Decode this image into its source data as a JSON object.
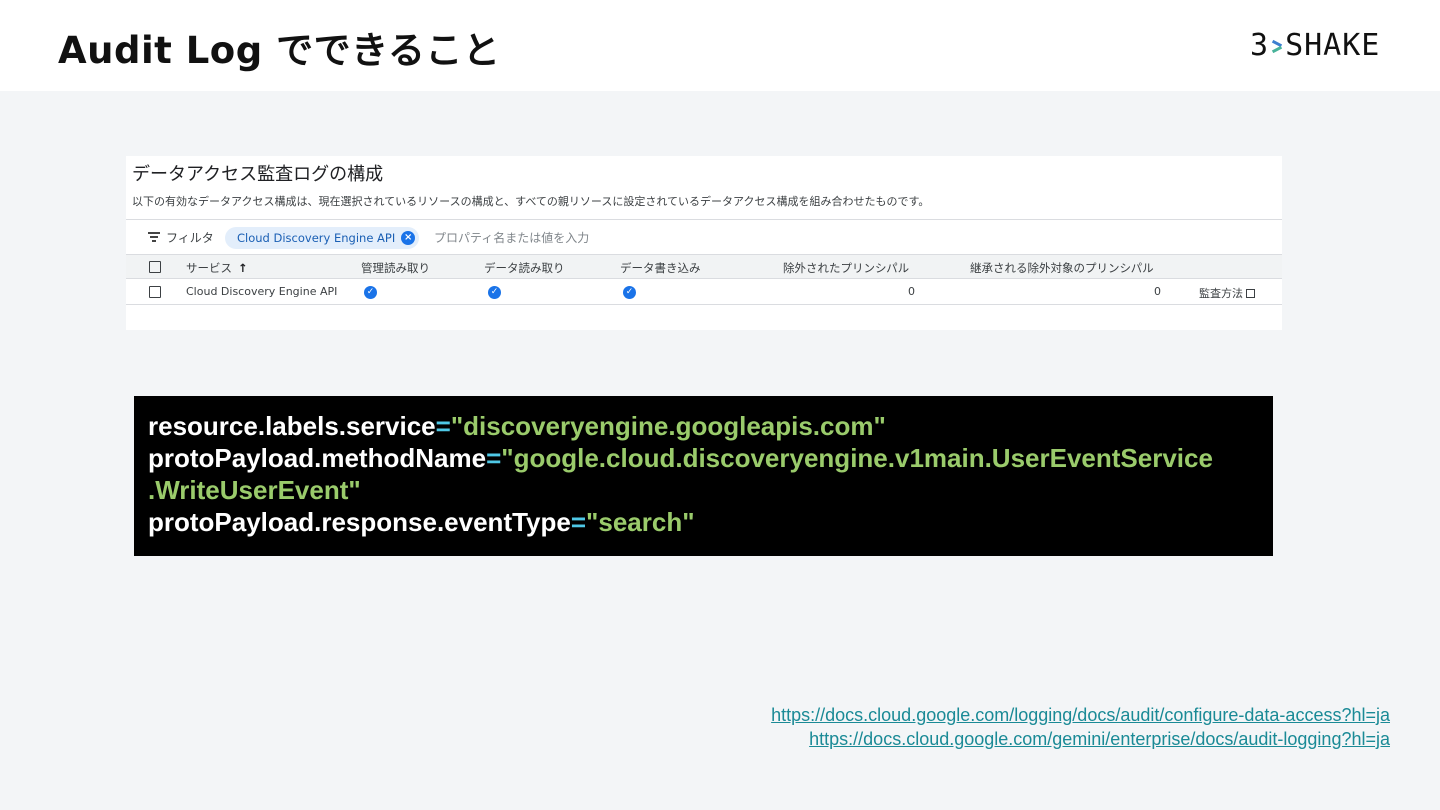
{
  "slide": {
    "title": "Audit Log でできること",
    "logo_text_left": "3",
    "logo_text_right": "SHAKE"
  },
  "panel": {
    "title": "データアクセス監査ログの構成",
    "description": "以下の有効なデータアクセス構成は、現在選択されているリソースの構成と、すべての親リソースに設定されているデータアクセス構成を組み合わせたものです。",
    "filter_label": "フィルタ",
    "filter_chip": "Cloud Discovery Engine API",
    "filter_placeholder": "プロパティ名または値を入力",
    "columns": {
      "service": "サービス",
      "admin_read": "管理読み取り",
      "data_read": "データ読み取り",
      "data_write": "データ書き込み",
      "excluded_principals": "除外されたプリンシパル",
      "inherited_excluded": "継承される除外対象のプリンシパル"
    },
    "row": {
      "service": "Cloud Discovery Engine API",
      "excluded_principals": "0",
      "inherited_excluded": "0",
      "audit_link": "監査方法"
    }
  },
  "code": {
    "line1_key": "resource.labels.service",
    "line1_value": "\"discoveryengine.googleapis.com\"",
    "line2_key": "protoPayload.methodName",
    "line2_value": "\"google.cloud.discoveryengine.v1main.UserEventService",
    "line3_value": ".WriteUserEvent\"",
    "line4_key": "protoPayload.response.eventType",
    "line4_value": "\"search\"",
    "equals": "="
  },
  "references": [
    "https://docs.cloud.google.com/logging/docs/audit/configure-data-access?hl=ja",
    "https://docs.cloud.google.com/gemini/enterprise/docs/audit-logging?hl=ja"
  ],
  "colors": {
    "code_key": "#ffffff",
    "code_equals": "#4fc8e6",
    "code_value": "#9acb6b",
    "link": "#1a8a96",
    "chip_bg": "#e3eefb",
    "check": "#1a73e8"
  }
}
